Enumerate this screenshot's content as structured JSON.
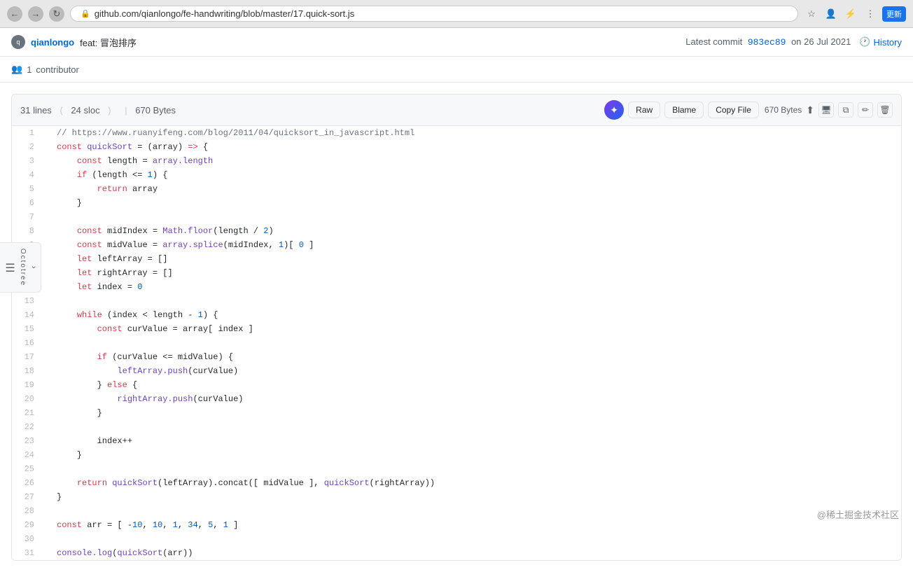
{
  "browser": {
    "url": "github.com/qianlongo/fe-handwriting/blob/master/17.quick-sort.js",
    "back_title": "back",
    "forward_title": "forward",
    "reload_title": "reload"
  },
  "commit": {
    "username": "qianlongo",
    "feat": "feat: 冒泡排序",
    "hash": "983ec89",
    "date": "on 26 Jul 2021",
    "latest_label": "Latest commit",
    "history_label": "History"
  },
  "contributor": {
    "count": "1",
    "label": "contributor"
  },
  "code_meta": {
    "lines": "31 lines",
    "sloc": "24 sloc",
    "size": "670 Bytes"
  },
  "toolbar": {
    "raw_label": "Raw",
    "blame_label": "Blame",
    "copy_file_label": "Copy File",
    "size_label": "670 Bytes"
  },
  "code_lines": [
    {
      "num": 1,
      "code": "// https://www.ruanyifeng.com/blog/2011/04/quicksort_in_javascript.html",
      "type": "comment"
    },
    {
      "num": 2,
      "code": "const quickSort = (array) => {",
      "type": "code"
    },
    {
      "num": 3,
      "code": "    const length = array.length",
      "type": "code"
    },
    {
      "num": 4,
      "code": "    if (length <= 1) {",
      "type": "code"
    },
    {
      "num": 5,
      "code": "        return array",
      "type": "code"
    },
    {
      "num": 6,
      "code": "    }",
      "type": "code"
    },
    {
      "num": 7,
      "code": "",
      "type": "blank"
    },
    {
      "num": 8,
      "code": "    const midIndex = Math.floor(length / 2)",
      "type": "code"
    },
    {
      "num": 9,
      "code": "    const midValue = array.splice(midIndex, 1)[ 0 ]",
      "type": "code"
    },
    {
      "num": 10,
      "code": "    let leftArray = []",
      "type": "code"
    },
    {
      "num": 11,
      "code": "    let rightArray = []",
      "type": "code"
    },
    {
      "num": 12,
      "code": "    let index = 0",
      "type": "code"
    },
    {
      "num": 13,
      "code": "",
      "type": "blank"
    },
    {
      "num": 14,
      "code": "    while (index < length - 1) {",
      "type": "code"
    },
    {
      "num": 15,
      "code": "        const curValue = array[ index ]",
      "type": "code"
    },
    {
      "num": 16,
      "code": "",
      "type": "blank"
    },
    {
      "num": 17,
      "code": "        if (curValue <= midValue) {",
      "type": "code"
    },
    {
      "num": 18,
      "code": "            leftArray.push(curValue)",
      "type": "code"
    },
    {
      "num": 19,
      "code": "        } else {",
      "type": "code"
    },
    {
      "num": 20,
      "code": "            rightArray.push(curValue)",
      "type": "code"
    },
    {
      "num": 21,
      "code": "        }",
      "type": "code"
    },
    {
      "num": 22,
      "code": "",
      "type": "blank"
    },
    {
      "num": 23,
      "code": "        index++",
      "type": "code"
    },
    {
      "num": 24,
      "code": "    }",
      "type": "code"
    },
    {
      "num": 25,
      "code": "",
      "type": "blank"
    },
    {
      "num": 26,
      "code": "    return quickSort(leftArray).concat([ midValue ], quickSort(rightArray))",
      "type": "code"
    },
    {
      "num": 27,
      "code": "}",
      "type": "code"
    },
    {
      "num": 28,
      "code": "",
      "type": "blank"
    },
    {
      "num": 29,
      "code": "const arr = [ -10, 10, 1, 34, 5, 1 ]",
      "type": "code"
    },
    {
      "num": 30,
      "code": "",
      "type": "blank"
    },
    {
      "num": 31,
      "code": "console.log(quickSort(arr))",
      "type": "code"
    }
  ],
  "watermark": "@稀土掘金技术社区",
  "octotree": {
    "label": "Octotree"
  }
}
